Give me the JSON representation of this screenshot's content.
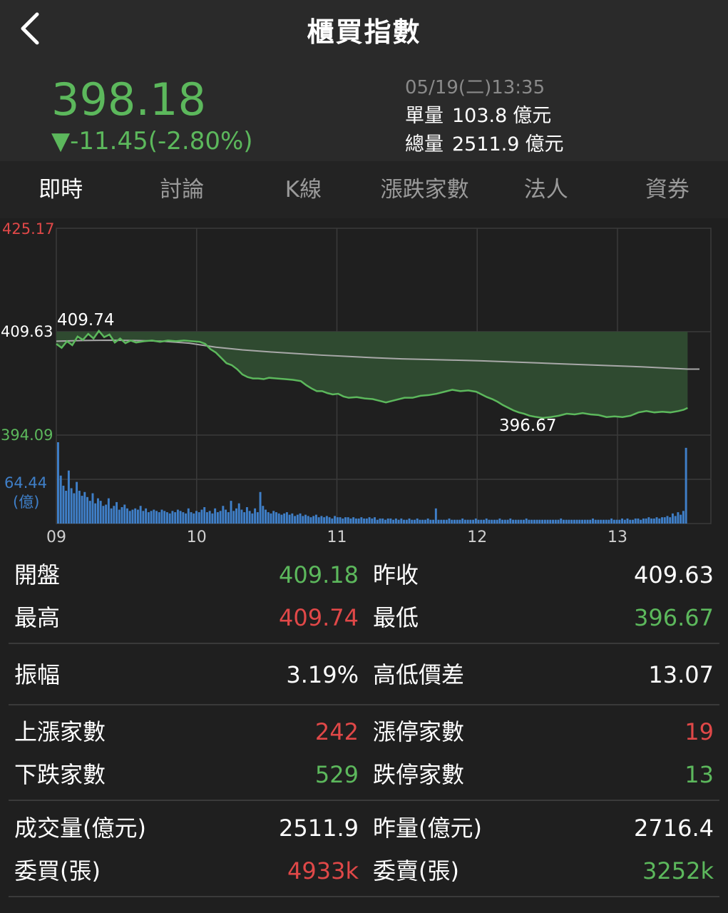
{
  "header": {
    "title": "櫃買指數"
  },
  "quote": {
    "price": "398.18",
    "change": "▼-11.45(-2.80%)",
    "time": "05/19(二)13:35",
    "unit_vol_label": "單量",
    "unit_vol_value": "103.8",
    "unit_vol_unit": "億元",
    "total_vol_label": "總量",
    "total_vol_value": "2511.9",
    "total_vol_unit": "億元"
  },
  "tabs": [
    {
      "label": "即時",
      "active": true
    },
    {
      "label": "討論"
    },
    {
      "label": "K線"
    },
    {
      "label": "漲跌家數"
    },
    {
      "label": "法人"
    },
    {
      "label": "資券"
    }
  ],
  "colors": {
    "up": "#e04848",
    "down": "#5cb85c",
    "volume": "#3f7fc8",
    "avg": "#a8a8a8"
  },
  "chart_data": {
    "type": "line",
    "y_axis_labels": {
      "top": "425.17",
      "ref": "409.63",
      "bottom": "394.09"
    },
    "ylim": [
      394.09,
      425.17
    ],
    "reference": 409.63,
    "x_ticks": [
      "09",
      "10",
      "11",
      "12",
      "13"
    ],
    "high_label": "409.74",
    "low_label": "396.67",
    "price_series": [
      [
        0,
        407.8
      ],
      [
        4,
        407.2
      ],
      [
        8,
        408.2
      ],
      [
        12,
        407.6
      ],
      [
        16,
        408.9
      ],
      [
        20,
        408.4
      ],
      [
        24,
        409.3
      ],
      [
        28,
        408.6
      ],
      [
        32,
        409.74
      ],
      [
        36,
        408.8
      ],
      [
        40,
        409.2
      ],
      [
        44,
        408.0
      ],
      [
        48,
        408.6
      ],
      [
        52,
        407.9
      ],
      [
        56,
        408.3
      ],
      [
        60,
        408.0
      ],
      [
        66,
        408.2
      ],
      [
        72,
        408.3
      ],
      [
        78,
        408.1
      ],
      [
        84,
        408.3
      ],
      [
        90,
        408.2
      ],
      [
        96,
        408.3
      ],
      [
        102,
        408.2
      ],
      [
        108,
        408.1
      ],
      [
        112,
        407.8
      ],
      [
        116,
        407.0
      ],
      [
        120,
        406.5
      ],
      [
        124,
        405.7
      ],
      [
        128,
        404.9
      ],
      [
        132,
        404.6
      ],
      [
        136,
        404.0
      ],
      [
        140,
        403.2
      ],
      [
        144,
        402.8
      ],
      [
        148,
        402.6
      ],
      [
        152,
        402.6
      ],
      [
        156,
        402.5
      ],
      [
        160,
        402.7
      ],
      [
        166,
        402.6
      ],
      [
        172,
        402.5
      ],
      [
        178,
        402.4
      ],
      [
        184,
        402.2
      ],
      [
        188,
        401.6
      ],
      [
        192,
        401.1
      ],
      [
        196,
        400.7
      ],
      [
        200,
        400.7
      ],
      [
        204,
        400.4
      ],
      [
        208,
        400.2
      ],
      [
        212,
        400.3
      ],
      [
        216,
        399.9
      ],
      [
        220,
        399.7
      ],
      [
        226,
        399.8
      ],
      [
        232,
        399.6
      ],
      [
        238,
        399.5
      ],
      [
        244,
        399.2
      ],
      [
        248,
        399.0
      ],
      [
        252,
        399.2
      ],
      [
        256,
        399.4
      ],
      [
        262,
        399.7
      ],
      [
        268,
        399.7
      ],
      [
        274,
        400.0
      ],
      [
        280,
        400.1
      ],
      [
        286,
        400.3
      ],
      [
        292,
        400.6
      ],
      [
        298,
        400.9
      ],
      [
        304,
        400.7
      ],
      [
        310,
        400.8
      ],
      [
        316,
        400.6
      ],
      [
        320,
        400.2
      ],
      [
        324,
        399.8
      ],
      [
        328,
        399.5
      ],
      [
        332,
        399.1
      ],
      [
        336,
        398.6
      ],
      [
        340,
        398.2
      ],
      [
        344,
        397.8
      ],
      [
        348,
        397.5
      ],
      [
        352,
        397.3
      ],
      [
        356,
        397.0
      ],
      [
        360,
        396.85
      ],
      [
        366,
        396.67
      ],
      [
        372,
        396.8
      ],
      [
        378,
        397.0
      ],
      [
        384,
        397.3
      ],
      [
        390,
        397.2
      ],
      [
        396,
        397.4
      ],
      [
        402,
        397.2
      ],
      [
        408,
        397.1
      ],
      [
        414,
        396.8
      ],
      [
        420,
        396.9
      ],
      [
        426,
        396.8
      ],
      [
        432,
        397.0
      ],
      [
        438,
        397.5
      ],
      [
        444,
        397.7
      ],
      [
        450,
        397.5
      ],
      [
        456,
        397.6
      ],
      [
        462,
        397.5
      ],
      [
        468,
        397.7
      ],
      [
        472,
        397.9
      ],
      [
        475,
        398.18
      ]
    ],
    "avg_series": [
      [
        0,
        408.2
      ],
      [
        20,
        408.3
      ],
      [
        40,
        408.35
      ],
      [
        60,
        408.3
      ],
      [
        80,
        408.2
      ],
      [
        100,
        407.9
      ],
      [
        120,
        407.3
      ],
      [
        140,
        406.9
      ],
      [
        160,
        406.6
      ],
      [
        180,
        406.35
      ],
      [
        200,
        406.1
      ],
      [
        220,
        405.9
      ],
      [
        240,
        405.7
      ],
      [
        260,
        405.55
      ],
      [
        280,
        405.45
      ],
      [
        300,
        405.35
      ],
      [
        320,
        405.25
      ],
      [
        340,
        405.1
      ],
      [
        360,
        404.95
      ],
      [
        380,
        404.8
      ],
      [
        400,
        404.65
      ],
      [
        420,
        404.5
      ],
      [
        440,
        404.35
      ],
      [
        460,
        404.15
      ],
      [
        475,
        404.0
      ]
    ],
    "volume": {
      "max_label": "64.44",
      "unit_label": "(億)",
      "max": 64.44,
      "values": [
        64.44,
        38,
        30,
        26,
        42,
        28,
        24,
        33,
        26,
        22,
        25,
        21,
        18,
        24,
        16,
        20,
        18,
        14,
        15,
        20,
        12,
        14,
        17,
        11,
        13,
        15,
        12,
        10,
        11,
        12,
        11,
        14,
        10,
        12,
        9,
        10,
        11,
        10,
        9,
        11,
        10,
        9,
        8,
        10,
        9,
        11,
        10,
        9,
        8,
        12,
        9,
        8,
        10,
        9,
        11,
        13,
        9,
        10,
        8,
        12,
        9,
        10,
        14,
        11,
        9,
        18,
        10,
        12,
        16,
        11,
        9,
        13,
        10,
        8,
        12,
        9,
        25,
        14,
        11,
        9,
        8,
        10,
        9,
        8,
        7,
        8,
        9,
        7,
        8,
        6,
        7,
        8,
        6,
        7,
        6,
        5,
        6,
        7,
        5,
        6,
        5,
        6,
        5,
        4,
        6,
        5,
        5,
        4,
        5,
        5,
        4,
        5,
        4,
        4,
        5,
        4,
        4,
        5,
        4,
        5,
        3,
        4,
        4,
        3,
        4,
        4,
        3,
        4,
        3,
        4,
        3,
        3,
        4,
        3,
        3,
        4,
        3,
        3,
        3,
        4,
        3,
        3,
        12,
        3,
        3,
        3,
        3,
        4,
        3,
        3,
        3,
        3,
        4,
        3,
        3,
        3,
        3,
        4,
        3,
        3,
        3,
        4,
        3,
        3,
        3,
        3,
        4,
        3,
        3,
        3,
        4,
        3,
        3,
        3,
        3,
        3,
        4,
        3,
        3,
        3,
        3,
        3,
        3,
        3,
        3,
        3,
        3,
        3,
        3,
        4,
        3,
        3,
        3,
        3,
        3,
        3,
        3,
        3,
        3,
        3,
        3,
        4,
        3,
        3,
        3,
        3,
        3,
        3,
        4,
        3,
        3,
        3,
        4,
        3,
        4,
        3,
        3,
        4,
        4,
        3,
        4,
        4,
        5,
        4,
        4,
        5,
        4,
        5,
        5,
        6,
        5,
        8,
        6,
        9,
        7,
        10,
        60
      ]
    }
  },
  "stats": {
    "open_label": "開盤",
    "open_value": "409.18",
    "prev_close_label": "昨收",
    "prev_close_value": "409.63",
    "high_label": "最高",
    "high_value": "409.74",
    "low_label": "最低",
    "low_value": "396.67",
    "amplitude_label": "振幅",
    "amplitude_value": "3.19%",
    "spread_label": "高低價差",
    "spread_value": "13.07",
    "up_count_label": "上漲家數",
    "up_count_value": "242",
    "limit_up_label": "漲停家數",
    "limit_up_value": "19",
    "down_count_label": "下跌家數",
    "down_count_value": "529",
    "limit_down_label": "跌停家數",
    "limit_down_value": "13",
    "turnover_label": "成交量(億元)",
    "turnover_value": "2511.9",
    "prev_turnover_label": "昨量(億元)",
    "prev_turnover_value": "2716.4",
    "bid_label": "委買(張)",
    "bid_value": "4933k",
    "ask_label": "委賣(張)",
    "ask_value": "3252k"
  }
}
